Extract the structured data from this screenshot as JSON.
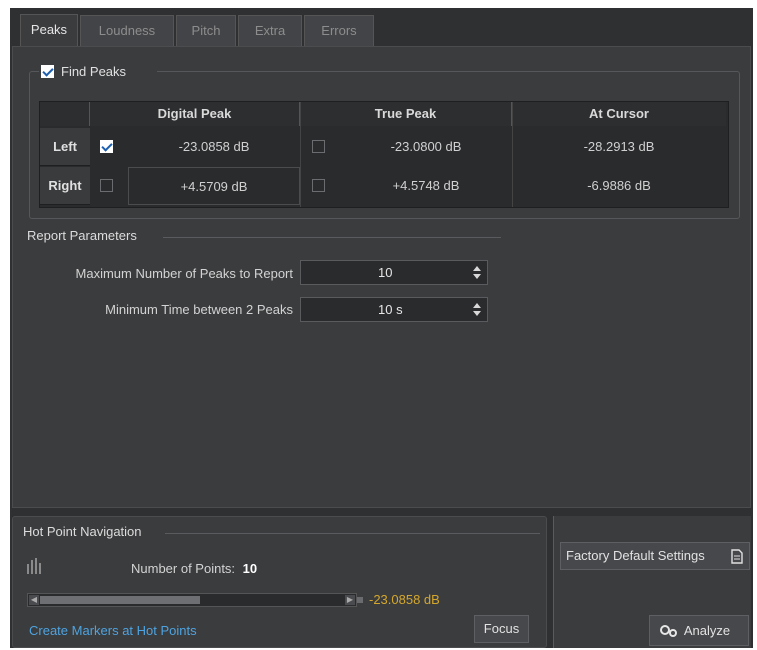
{
  "tabs": [
    {
      "label": "Peaks",
      "active": true
    },
    {
      "label": "Loudness",
      "active": false
    },
    {
      "label": "Pitch",
      "active": false
    },
    {
      "label": "Extra",
      "active": false
    },
    {
      "label": "Errors",
      "active": false
    }
  ],
  "find_peaks": {
    "label": "Find Peaks",
    "checked": true
  },
  "table": {
    "columns": [
      "Digital Peak",
      "True Peak",
      "At Cursor"
    ],
    "rows": [
      {
        "label": "Left",
        "digital_checked": true,
        "digital": "-23.0858 dB",
        "true_checked": false,
        "true_peak": "-23.0800 dB",
        "at_cursor": "-28.2913 dB"
      },
      {
        "label": "Right",
        "digital_checked": false,
        "digital": "+4.5709 dB",
        "true_checked": false,
        "true_peak": "+4.5748 dB",
        "at_cursor": "-6.9886 dB"
      }
    ]
  },
  "report": {
    "title": "Report Parameters",
    "max_peaks_label": "Maximum Number of Peaks to Report",
    "max_peaks_value": "10",
    "min_time_label": "Minimum Time between 2 Peaks",
    "min_time_value": "10 s"
  },
  "hot_point": {
    "title": "Hot Point Navigation",
    "points_label": "Number of Points:",
    "points_value": "10",
    "readout": "-23.0858 dB",
    "create_markers": "Create Markers at Hot Points",
    "focus": "Focus"
  },
  "buttons": {
    "factory_defaults": "Factory Default Settings",
    "analyze": "Analyze"
  },
  "colors": {
    "accent_link": "#4ea3e0",
    "readout": "#d4a72c"
  }
}
